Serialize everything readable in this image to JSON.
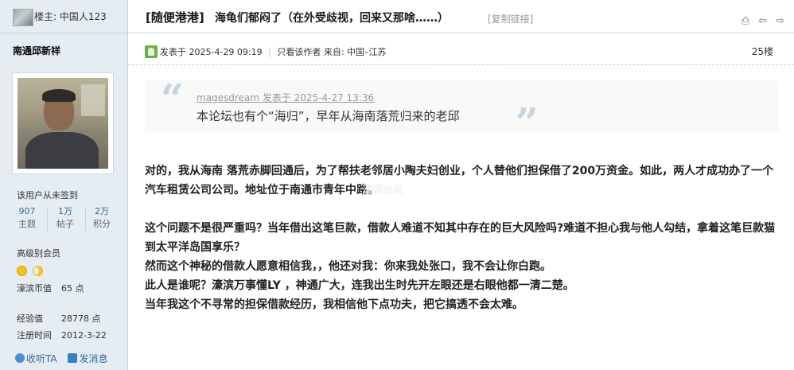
{
  "sidebar": {
    "op_label": "楼主: 中国人123",
    "username": "南通邱新祥",
    "checkin_status": "该用户从未签到",
    "stats": [
      {
        "value": "907",
        "label": "主题"
      },
      {
        "value": "1万",
        "label": "帖子"
      },
      {
        "value": "2万",
        "label": "积分"
      }
    ],
    "group": "高级别会员",
    "currency_label": "濠滨币值",
    "currency_value": "65 点",
    "exp_label": "经验值",
    "exp_value": "28778 点",
    "reg_label": "注册时间",
    "reg_value": "2012-3-22",
    "follow_label": "收听TA",
    "message_label": "发消息"
  },
  "header": {
    "forum_tag": "[随便港港]",
    "title": "海龟们郁闷了（在外受歧视，回来又那啥……）",
    "copy_link": "[复制链接]"
  },
  "meta": {
    "posted": "发表于 2025-4-29 09:19",
    "only_author": "只看该作者",
    "source": "来自:  中国–江苏",
    "floor": "25楼"
  },
  "quote": {
    "author_line": "magesdream 发表于 2025-4-27 13:36",
    "text": "本论坛也有个“海归”，早年从海南落荒归来的老邱"
  },
  "body": {
    "p1": "对的，我从海南 落荒赤脚回通后，为了帮扶老邻居小陶夫妇创业，个人替他们担保借了200万资金。如此，两人才成功办了一个汽车租赁公司公司。地址位于南通市青年中路。",
    "p2": "这个问题不是很严重吗？当年借出这笔巨款，借款人难道不知其中存在的巨大风险吗?难道不担心我与他人勾结，拿着这笔巨款猫到太平洋岛国享乐？",
    "p3": "然而这个神秘的借款人愿意相信我，，他还对我：你来我处张口，我不会让你白跑。",
    "p4": "此人是谁呢？濠滨万事懂LY ，神通广大，连我出生时先开左眼还是右眼他都一清二楚。",
    "p5": "当年我这个不寻常的担保借款经历，我相信他下点功夫，把它搞透不会太难。"
  },
  "watermark": "濠滨论坛",
  "colors": {
    "sidebar_bg": "#e5edf2",
    "border": "#c2d5e3",
    "link": "#336699",
    "quote_bg": "#f9f9f9"
  }
}
